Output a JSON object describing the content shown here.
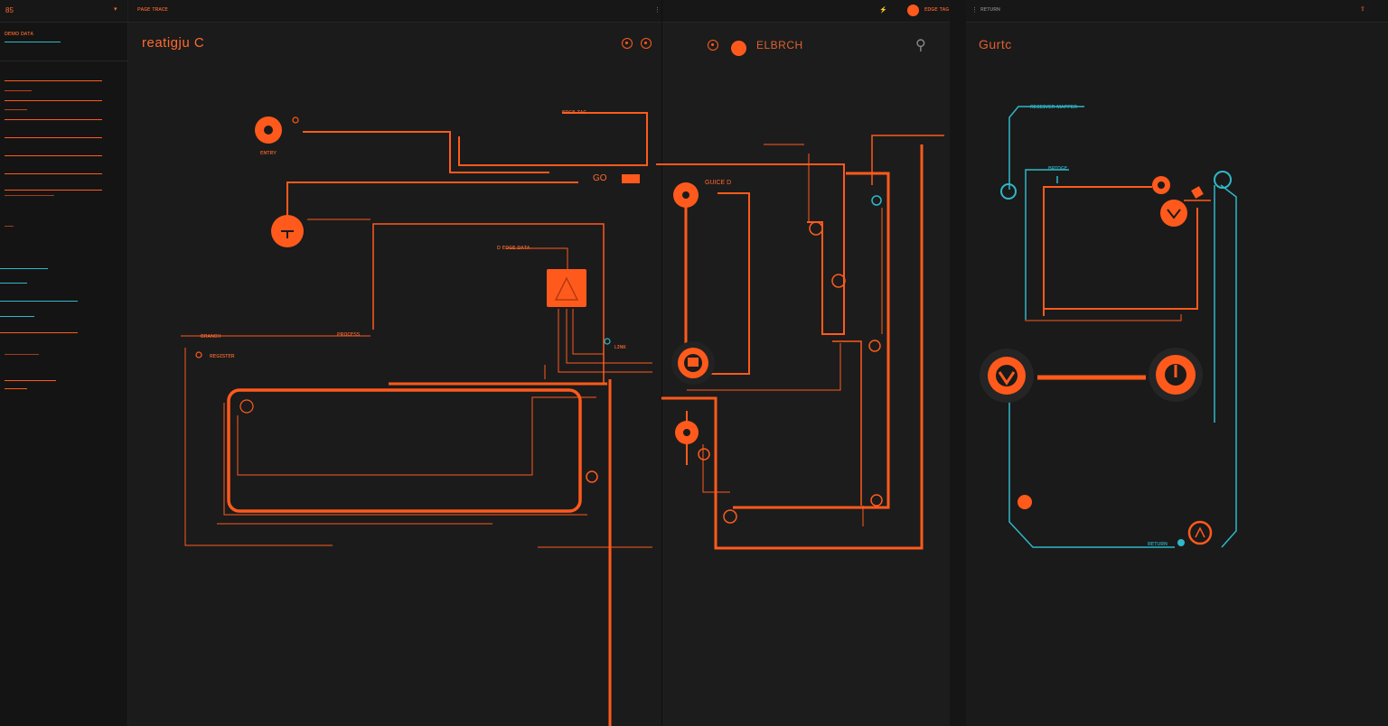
{
  "sidebar": {
    "header_label": "85",
    "header_caret": "▾",
    "section_title": "ᴅᴇᴍᴏ ᴅᴀᴛᴀ"
  },
  "editor": {
    "topbar_label": "ᴘᴀɢᴇ ᴛʀᴀᴄᴇ",
    "title": "reatigju C",
    "node_labels": {
      "entry": "ᴇɴᴛʀʏ",
      "flow_a": "ᴅ ᴇᴅɢᴇ ᴅᴀᴛᴀ",
      "flow_b": "ᴇᴅɢᴇ ᴛᴀɢ",
      "branch": "ʙʀᴀɴᴄʜ",
      "stage": "ᴘʀᴏᴄᴇss",
      "link": "ʟɪɴᴋ",
      "stack": "ʀᴇɢɪsᴛᴇʀ",
      "go": "GO"
    }
  },
  "center": {
    "title": "ELBRCH",
    "node_label": "GUICE D",
    "header_tag": "ᴇᴅɢᴇ ᴛᴀɢ"
  },
  "right": {
    "title": "Gurtc",
    "tag_a": "ʀᴇᴄᴇɪᴠᴇʀ ᴍᴀᴘᴘᴇʀ",
    "tag_b": "ʙʀɪᴅɢᴇ",
    "tag_c": "ʀᴇᴛᴜʀɴ"
  },
  "colors": {
    "accent": "#ff5a1c",
    "teal": "#2fb8c8",
    "bg": "#1b1b1b"
  },
  "icons": {
    "settings": "gear-icon",
    "record": "record-icon",
    "share": "share-icon",
    "pin": "pin-icon"
  }
}
